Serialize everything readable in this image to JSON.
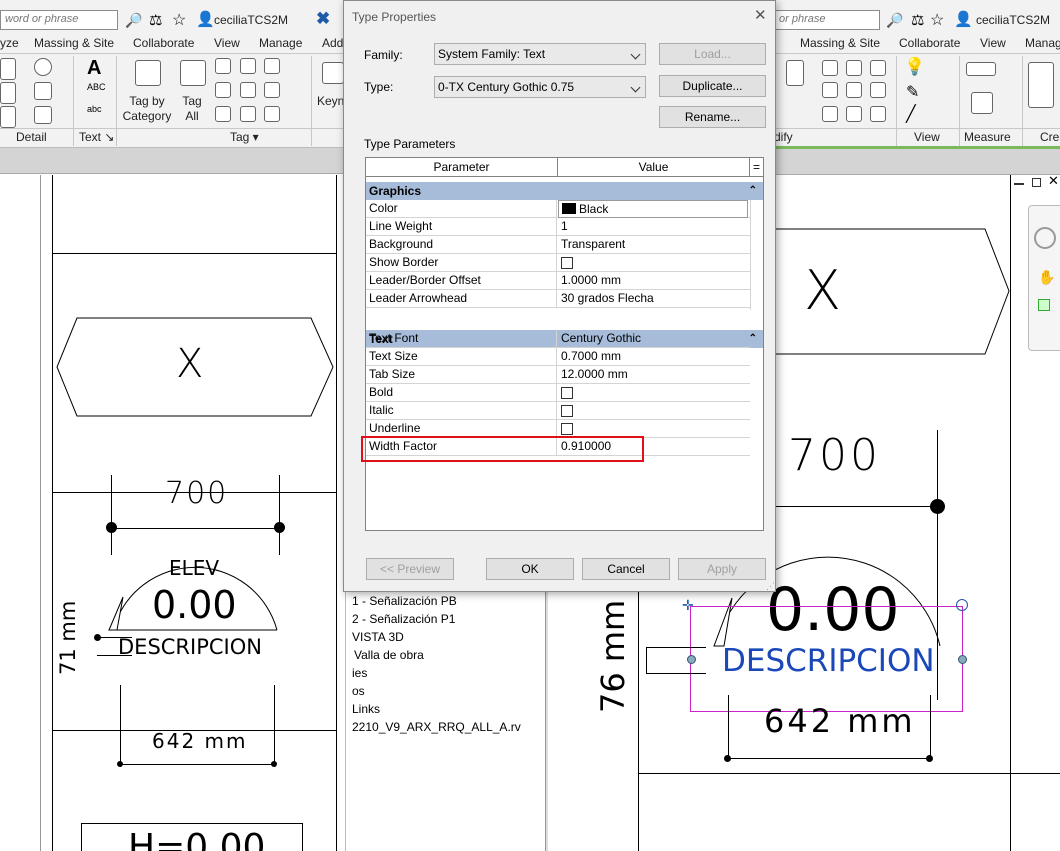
{
  "left_ribbon": {
    "search_placeholder": "word or phrase",
    "user": "ceciliaTCS2M",
    "tabs": [
      "yze",
      "Massing & Site",
      "Collaborate",
      "View",
      "Manage",
      "Add"
    ],
    "tag_by_category_label": "Tag by\nCategory",
    "tag_all_label": "Tag\nAll",
    "keynote_label": "Keyn",
    "panels": [
      "Detail",
      "Text ↘",
      "Tag ▾"
    ]
  },
  "right_ribbon": {
    "search_placeholder": "or phrase",
    "user": "ceciliaTCS2M",
    "tabs": [
      "Massing & Site",
      "Collaborate",
      "View",
      "Manag"
    ],
    "panels": [
      "dify",
      "View",
      "Measure",
      "Crea"
    ]
  },
  "left_drawing": {
    "hex_text": "X",
    "dim_700": "700",
    "elev_label": "ELEV",
    "elev_value": "0.00",
    "description": "DESCRIPCION",
    "dim_71": "71 mm",
    "dim_642": "642 mm",
    "bottom_text": "H=0.00"
  },
  "right_drawing": {
    "hex_text": "X",
    "dim_700": "700",
    "elev_value": "0.00",
    "description": "DESCRIPCION",
    "dim_76": "76 mm",
    "dim_642": "642 mm"
  },
  "project_browser": {
    "items": [
      "1 - Señalización PB",
      "2 - Señalización P1",
      "VISTA 3D",
      "Valla de obra",
      "ies",
      "os",
      "Links",
      "2210_V9_ARX_RRQ_ALL_A.rv"
    ]
  },
  "dialog": {
    "title": "Type Properties",
    "family_label": "Family:",
    "family_value": "System Family: Text",
    "type_label": "Type:",
    "type_value": "0-TX Century Gothic 0.75",
    "load_button": "Load...",
    "duplicate_button": "Duplicate...",
    "rename_button": "Rename...",
    "type_parameters_label": "Type Parameters",
    "col_parameter": "Parameter",
    "col_value": "Value",
    "col_equals": "=",
    "groups": [
      {
        "name": "Graphics",
        "rows": [
          {
            "param": "Color",
            "value": "Black"
          },
          {
            "param": "Line Weight",
            "value": "1"
          },
          {
            "param": "Background",
            "value": "Transparent"
          },
          {
            "param": "Show Border",
            "value": ""
          },
          {
            "param": "Leader/Border Offset",
            "value": "1.0000 mm"
          },
          {
            "param": "Leader Arrowhead",
            "value": "30 grados Flecha"
          }
        ]
      },
      {
        "name": "Text",
        "rows": [
          {
            "param": "Text Font",
            "value": "Century Gothic"
          },
          {
            "param": "Text Size",
            "value": "0.7000 mm"
          },
          {
            "param": "Tab Size",
            "value": "12.0000 mm"
          },
          {
            "param": "Bold",
            "value": ""
          },
          {
            "param": "Italic",
            "value": ""
          },
          {
            "param": "Underline",
            "value": ""
          },
          {
            "param": "Width Factor",
            "value": "0.910000"
          }
        ]
      }
    ],
    "preview_button": "<< Preview",
    "ok_button": "OK",
    "cancel_button": "Cancel",
    "apply_button": "Apply",
    "highlight_color": "#e0101a",
    "group_header_color": "#a7bcd9"
  }
}
